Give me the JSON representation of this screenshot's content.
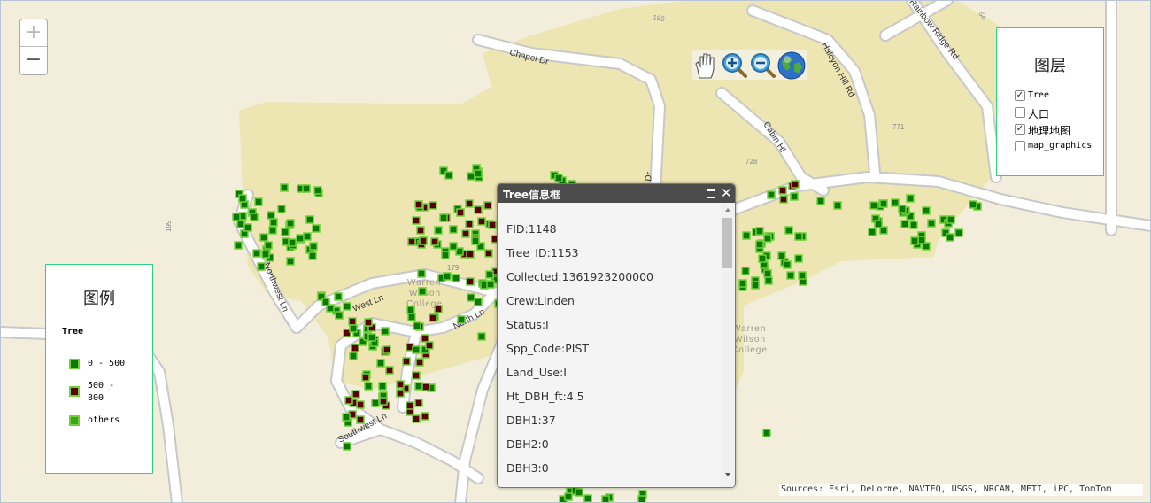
{
  "zoom": {
    "in_label": "+",
    "out_label": "−"
  },
  "toolbar": {
    "tools": [
      "pan-hand-icon",
      "zoom-in-icon",
      "zoom-out-icon",
      "full-extent-globe-icon"
    ]
  },
  "map": {
    "road_labels": [
      "Chapel Dr",
      "Halcyon Hill Rd",
      "Rainbow Ridge Rd",
      "Cabin Hl",
      "Northwest Ln",
      "West Ln",
      "North Ln",
      "Southwest Ln",
      "Dr"
    ],
    "route_numbers": [
      "199",
      "199",
      "54",
      "771",
      "728",
      "179"
    ],
    "place_labels": [
      [
        "Warren",
        "Wilson",
        "College"
      ],
      [
        "Warren",
        "Wilson",
        "College"
      ]
    ]
  },
  "legend": {
    "title": "图例",
    "layer": "Tree",
    "items": [
      {
        "label_lines": [
          "0 - 500"
        ],
        "color": "#0b7a00"
      },
      {
        "label_lines": [
          "500 -",
          "800"
        ],
        "color": "#5a0000"
      },
      {
        "label_lines": [
          "others"
        ],
        "color": "#3da615"
      }
    ]
  },
  "layers": {
    "title": "图层",
    "items": [
      {
        "label": "Tree",
        "checked": true
      },
      {
        "label": "人口",
        "checked": false
      },
      {
        "label": "地理地图",
        "checked": true
      },
      {
        "label": "map_graphics",
        "checked": false
      }
    ]
  },
  "popup": {
    "title": "Tree信息框",
    "fields": [
      "FID:1148",
      "Tree_ID:1153",
      "Collected:1361923200000",
      "Crew:Linden",
      "Status:I",
      "Spp_Code:PIST",
      "Land_Use:I",
      "Ht_DBH_ft:4.5",
      "DBH1:37",
      "DBH2:0",
      "DBH3:0"
    ]
  },
  "attribution": "Sources: Esri, DeLorme, NAVTEQ, USGS, NRCAN, METI, iPC, TomTom",
  "colors": {
    "map_background": "#f2eedb",
    "campus_area": "#ede5b2",
    "road": "#ffffff",
    "road_casing": "#c8c8c8",
    "tree_green": "#0b7a00",
    "tree_brown": "#5a0000",
    "tree_outline": "#6fd13a",
    "panel_border": "#2fd27f"
  }
}
